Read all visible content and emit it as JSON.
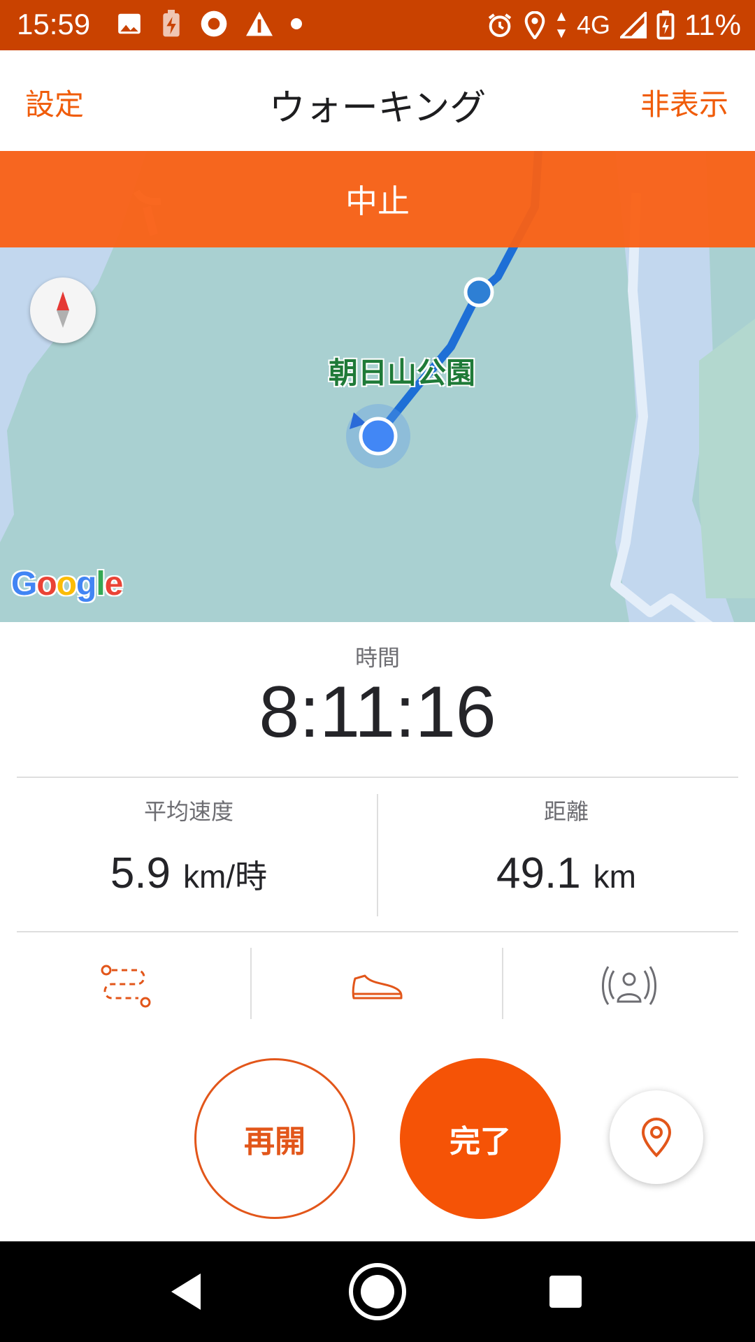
{
  "status_bar": {
    "time": "15:59",
    "network": "4G",
    "battery_percent": "11%",
    "left_icons": [
      "image-icon",
      "battery-saver-icon",
      "circle-app-icon",
      "triangle-app-icon",
      "dot-icon"
    ],
    "right_icons": [
      "alarm-icon",
      "location-icon",
      "data-arrows-icon",
      "signal-icon",
      "battery-charging-icon"
    ]
  },
  "header": {
    "settings_label": "設定",
    "title": "ウォーキング",
    "hide_label": "非表示"
  },
  "map": {
    "stop_banner": "中止",
    "park_label": "朝日山公園",
    "google_logo": "Google"
  },
  "stats": {
    "time_label": "時間",
    "time_value": "8:11:16",
    "avg_speed_label": "平均速度",
    "avg_speed_value": "5.9",
    "avg_speed_unit": "km/時",
    "distance_label": "距離",
    "distance_value": "49.1",
    "distance_unit": "km"
  },
  "icon_row": [
    "route-icon",
    "shoe-icon",
    "beacon-icon"
  ],
  "buttons": {
    "resume": "再開",
    "finish": "完了"
  },
  "colors": {
    "accent": "#f55306",
    "status_bar": "#c94200",
    "route": "#1e6fd6"
  }
}
